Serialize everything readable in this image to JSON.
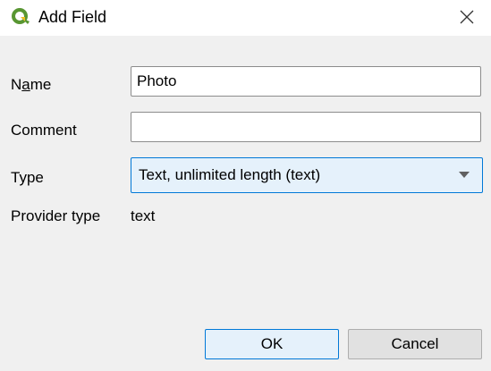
{
  "window": {
    "title": "Add Field",
    "app_icon": "qgis-logo-icon",
    "close_icon": "close-icon"
  },
  "form": {
    "name_label_prefix": "N",
    "name_label_mnemonic": "a",
    "name_label_suffix": "me",
    "name_value": "Photo",
    "comment_label": "Comment",
    "comment_value": "",
    "type_label": "Type",
    "type_value": "Text, unlimited length (text)",
    "provider_type_label": "Provider type",
    "provider_type_value": "text"
  },
  "buttons": {
    "ok_label": "OK",
    "cancel_label": "Cancel"
  },
  "colors": {
    "accent": "#0078d7",
    "qgis_green": "#589632",
    "qgis_yellow": "#eebe22"
  }
}
